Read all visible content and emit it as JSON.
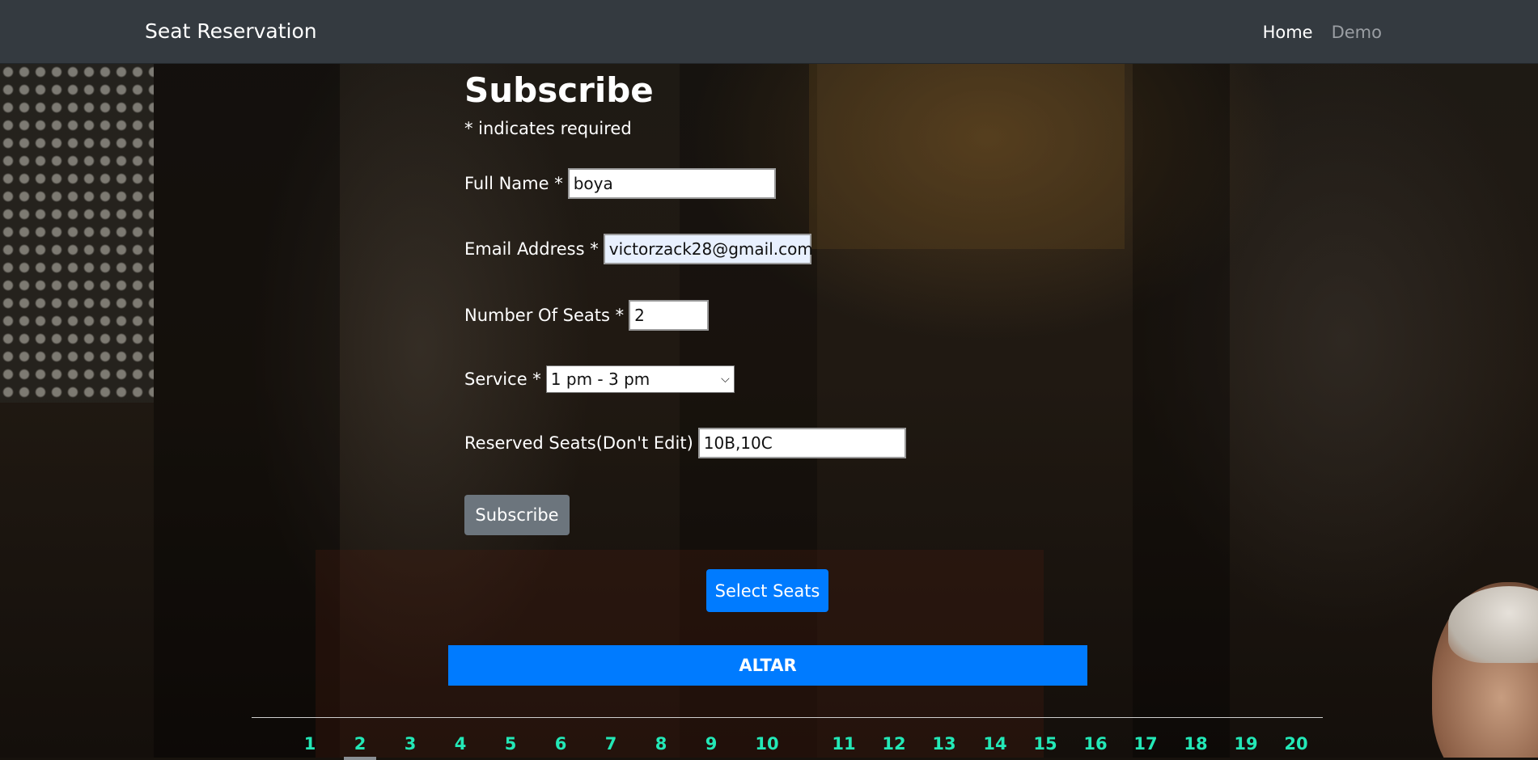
{
  "navbar": {
    "brand": "Seat Reservation",
    "links": [
      {
        "label": "Home",
        "state": "active"
      },
      {
        "label": "Demo",
        "state": "inactive"
      }
    ]
  },
  "form": {
    "title": "Subscribe",
    "required_note": "* indicates required",
    "fields": {
      "full_name": {
        "label": "Full Name *",
        "value": "boya"
      },
      "email": {
        "label": "Email Address *",
        "value": "victorzack28@gmail.com"
      },
      "seats": {
        "label": "Number Of Seats *",
        "value": "2"
      },
      "service": {
        "label": "Service *",
        "selected": "1 pm - 3 pm"
      },
      "reserved": {
        "label": "Reserved Seats(Don't Edit)",
        "value": "10B,10C"
      }
    },
    "submit_label": "Subscribe"
  },
  "select_seats_label": "Select Seats",
  "altar_label": "ALTAR",
  "seat_numbers": [
    "1",
    "2",
    "3",
    "4",
    "5",
    "6",
    "7",
    "8",
    "9",
    "10",
    "11",
    "12",
    "13",
    "14",
    "15",
    "16",
    "17",
    "18",
    "19",
    "20"
  ],
  "colors": {
    "navbar": "#343a40",
    "primary": "#007bff",
    "secondary": "#6c757d",
    "seat_number": "#23e8b7",
    "autofill": "#e8f0fe"
  }
}
